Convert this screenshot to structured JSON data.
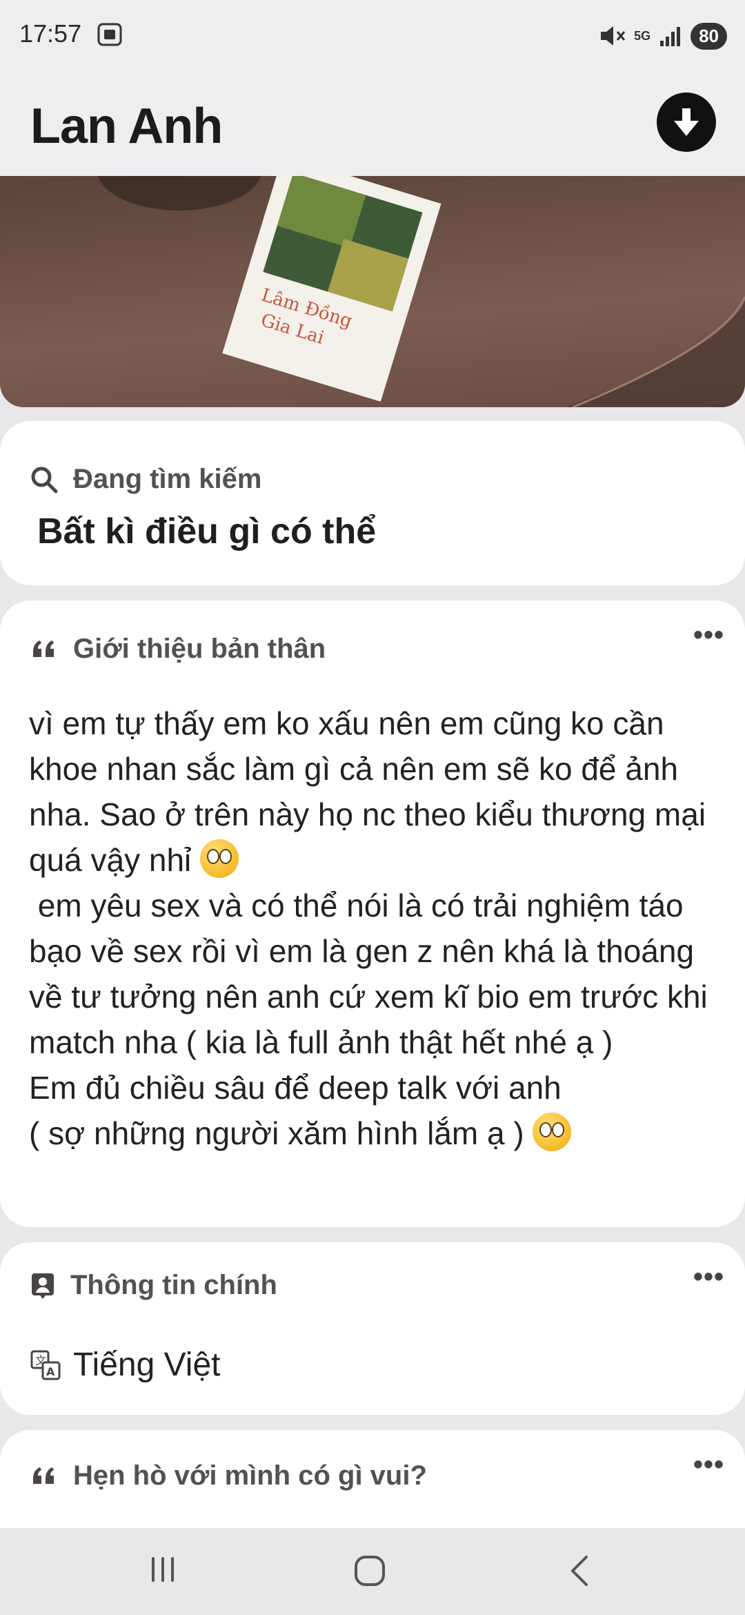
{
  "status_bar": {
    "time": "17:57",
    "network": "5G",
    "battery": "80"
  },
  "header": {
    "title": "Lan Anh",
    "download_icon": "download-arrow-icon"
  },
  "photo": {
    "postcard_text_line1": "Lâm Đồng",
    "postcard_text_line2": "Gia Lai"
  },
  "looking_for": {
    "label": "Đang tìm kiếm",
    "value": "Bất kì điều gì có thể"
  },
  "bio": {
    "label": "Giới thiệu bản thân",
    "more": "•••",
    "line1": "vì em tự thấy em ko xấu nên em cũng ko cần khoe nhan sắc làm gì cả nên em sẽ ko để ảnh nha. Sao ở trên này họ nc theo kiểu thương mại quá vậy nhỉ",
    "line2": " em yêu sex và có thể nói là có trải nghiệm táo bạo về sex rồi vì em là gen z nên khá là thoáng về tư tưởng nên anh cứ xem kĩ bio em trước khi match nha ( kia là full ảnh thật hết nhé ạ )",
    "line3": "Em đủ chiều sâu để deep talk với anh",
    "line4": "( sợ những người xăm hình lắm ạ )"
  },
  "main_info": {
    "label": "Thông tin chính",
    "more": "•••",
    "language": "Tiếng Việt"
  },
  "dating_fun": {
    "label": "Hẹn hò với mình có gì vui?",
    "more": "•••"
  }
}
